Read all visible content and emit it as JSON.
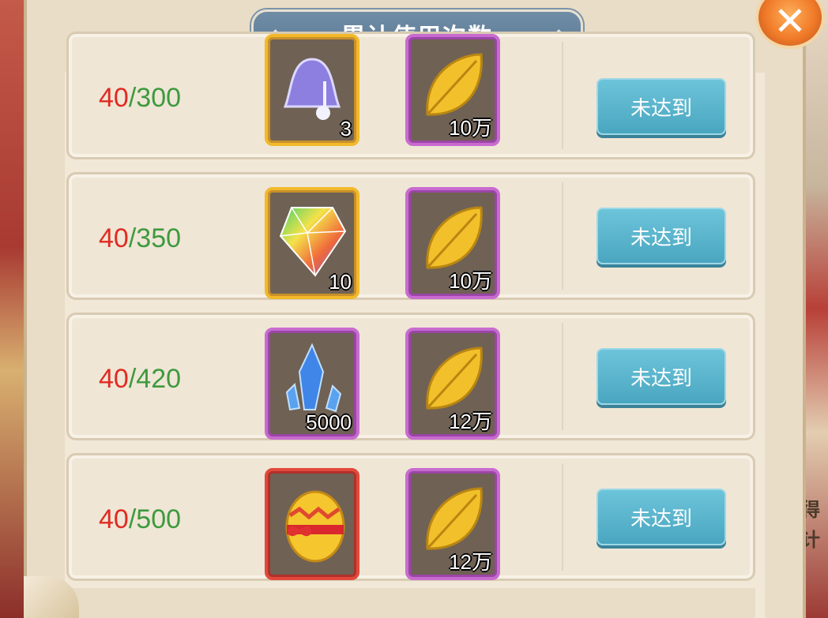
{
  "dialog": {
    "title": "累计使用次数",
    "close_icon": "close-x-icon"
  },
  "rows": [
    {
      "current": "40",
      "separator": "/",
      "goal": "300",
      "reward1": {
        "icon": "music-bell-icon",
        "qty": "3",
        "rarity": "gold"
      },
      "reward2": {
        "icon": "gold-leaf-icon",
        "qty": "10万",
        "rarity": "purple"
      },
      "button": "未达到"
    },
    {
      "current": "40",
      "separator": "/",
      "goal": "350",
      "reward1": {
        "icon": "rainbow-gem-icon",
        "qty": "10",
        "rarity": "gold"
      },
      "reward2": {
        "icon": "gold-leaf-icon",
        "qty": "10万",
        "rarity": "purple"
      },
      "button": "未达到"
    },
    {
      "current": "40",
      "separator": "/",
      "goal": "420",
      "reward1": {
        "icon": "blue-crystal-icon",
        "qty": "5000",
        "rarity": "purple"
      },
      "reward2": {
        "icon": "gold-leaf-icon",
        "qty": "12万",
        "rarity": "purple"
      },
      "button": "未达到"
    },
    {
      "current": "40",
      "separator": "/",
      "goal": "500",
      "reward1": {
        "icon": "gift-egg-icon",
        "qty": "",
        "rarity": "red"
      },
      "reward2": {
        "icon": "gold-leaf-icon",
        "qty": "12万",
        "rarity": "purple"
      },
      "button": "未达到"
    }
  ],
  "background_side_text": [
    "得",
    "计"
  ],
  "colors": {
    "current_progress": "#e02b21",
    "goal_progress": "#3e9a3e",
    "button": "#5ab4cc",
    "title_plate": "#607f99"
  }
}
